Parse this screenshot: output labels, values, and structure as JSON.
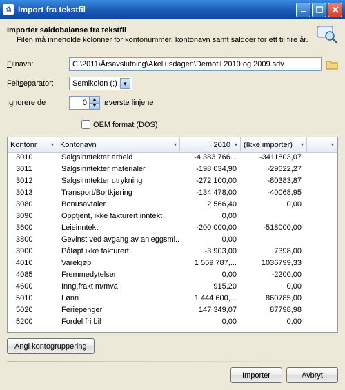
{
  "window": {
    "title": "Import fra tekstfil"
  },
  "header": {
    "title": "Importer saldobalanse fra tekstfil",
    "subtitle": "Filen må inneholde kolonner for kontonummer, kontonavn samt saldoer for ett til fire år."
  },
  "form": {
    "filnavn_label": "Filnavn:",
    "filnavn_value": "C:\\2011\\Årsavslutning\\Akeliusdagen\\Demofil 2010 og 2009.sdv",
    "feltseparator_label": "Feltseparator:",
    "feltseparator_value": "Semikolon (;)",
    "ignorere_label": "Ignorere de",
    "ignorere_value": "0",
    "ignorere_suffix": "øverste linjene",
    "oem_label": "OEM format (DOS)"
  },
  "grid": {
    "columns": [
      "Kontonr",
      "Kontonavn",
      "2010",
      "(Ikke importer)"
    ],
    "rows": [
      {
        "k": "3010",
        "n": "Salgsinntekter arbeid",
        "a": "-4 383 766...",
        "b": "-3411803,07"
      },
      {
        "k": "3011",
        "n": "Salgsinntekter materialer",
        "a": "-198 034,90",
        "b": "-29622,27"
      },
      {
        "k": "3012",
        "n": "Salgsinntekter utrykning",
        "a": "-272 100,00",
        "b": "-80383,87"
      },
      {
        "k": "3013",
        "n": "Transport/Bortkjøring",
        "a": "-134 478,00",
        "b": "-40068,95"
      },
      {
        "k": "3080",
        "n": "Bonusavtaler",
        "a": "2 566,40",
        "b": "0,00"
      },
      {
        "k": "3090",
        "n": "Opptjent, ikke fakturert inntekt",
        "a": "0,00",
        "b": ""
      },
      {
        "k": "3600",
        "n": "Leieinntekt",
        "a": "-200 000,00",
        "b": "-518000,00"
      },
      {
        "k": "3800",
        "n": "Gevinst ved avgang av anleggsmi...",
        "a": "0,00",
        "b": ""
      },
      {
        "k": "3900",
        "n": "Påløpt ikke fakturert",
        "a": "-3 903,00",
        "b": "7398,00"
      },
      {
        "k": "4010",
        "n": "Varekjøp",
        "a": "1 559 787,...",
        "b": "1036799,33"
      },
      {
        "k": "4085",
        "n": "Fremmedytelser",
        "a": "0,00",
        "b": "-2200,00"
      },
      {
        "k": "4600",
        "n": "Inng.frakt m/mva",
        "a": "915,20",
        "b": "0,00"
      },
      {
        "k": "5010",
        "n": "Lønn",
        "a": "1 444 600,...",
        "b": "860785,00"
      },
      {
        "k": "5020",
        "n": "Feriepenger",
        "a": "147 349,07",
        "b": "87798,98"
      },
      {
        "k": "5200",
        "n": "Fordel fri bil",
        "a": "0,00",
        "b": "0,00"
      }
    ]
  },
  "buttons": {
    "grouping": "Angi kontogruppering",
    "import": "Importer",
    "cancel": "Avbryt"
  }
}
